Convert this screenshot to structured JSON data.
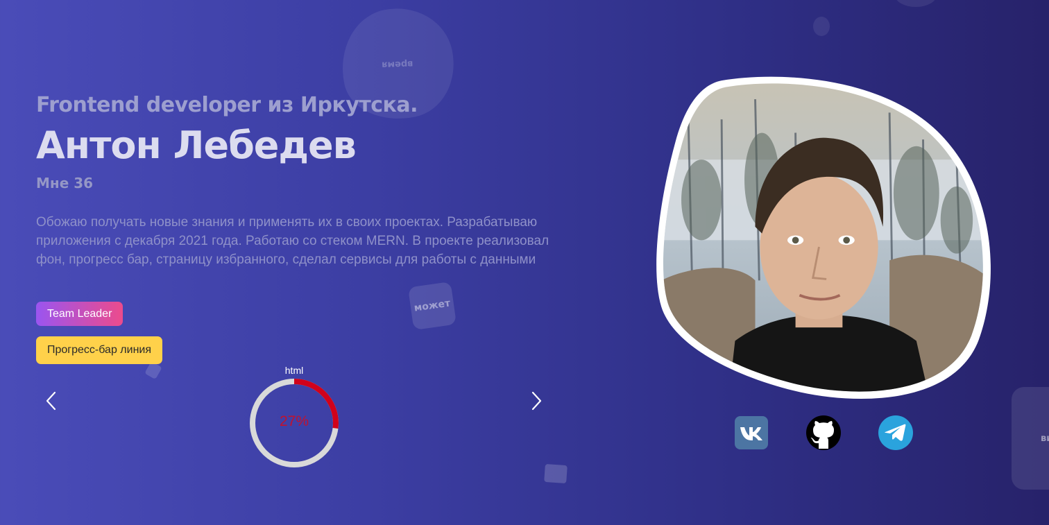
{
  "hero": {
    "subtitle": "Frontend developer из Иркутска.",
    "name": "Антон Лебедев",
    "age": "Мне 36",
    "about": "Обожаю получать новые знания и применять их в своих проектах. Разрабатываю приложения с декабря 2021 года. Работаю со стеком MERN. В проекте реализовал фон, прогресс бар, страницу избранного, сделал сервисы для работы с данными"
  },
  "buttons": {
    "team_leader": "Team Leader",
    "progress_bar": "Прогресс-бар линия"
  },
  "background_words": {
    "blob": "время",
    "square": "может",
    "right_card": "ви"
  },
  "skill_progress": {
    "label": "html",
    "value_text": "27%",
    "value_fraction": 0.27,
    "colors": {
      "fill": "#d0021b",
      "track": "#d9d9d9"
    }
  },
  "carousel": {
    "prev_icon": "chevron-left-icon",
    "next_icon": "chevron-right-icon"
  },
  "social": {
    "items": [
      {
        "name": "vk-icon",
        "color": "#4c75a3"
      },
      {
        "name": "github-icon",
        "color": "#000000"
      },
      {
        "name": "telegram-icon",
        "color": "#2aa3dd"
      }
    ]
  },
  "photo": {
    "icon": "profile-photo"
  }
}
